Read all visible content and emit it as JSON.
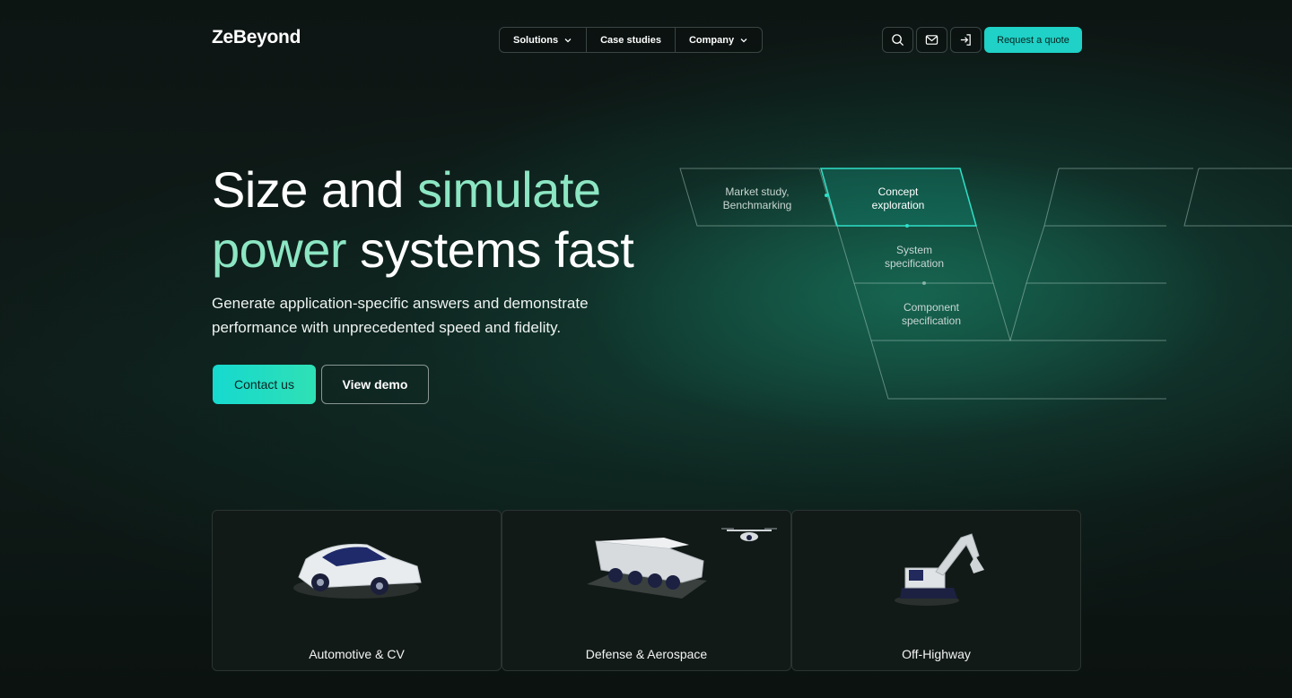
{
  "header": {
    "logo": "ZeBeyond",
    "nav": [
      {
        "label": "Solutions",
        "has_dropdown": true
      },
      {
        "label": "Case studies",
        "has_dropdown": false
      },
      {
        "label": "Company",
        "has_dropdown": true
      }
    ],
    "icons": [
      "search-icon",
      "mail-icon",
      "login-icon"
    ],
    "cta_label": "Request a quote"
  },
  "hero": {
    "title_line1_a": "Size and ",
    "title_line1_b": "simulate",
    "title_line2_a": "power",
    "title_line2_b": " systems fast",
    "subtitle": "Generate application-specific answers and demonstrate performance with unprecedented speed and fidelity.",
    "primary_button": "Contact us",
    "secondary_button": "View demo"
  },
  "diagram": {
    "steps": [
      {
        "line1": "Market study,",
        "line2": "Benchmarking"
      },
      {
        "line1": "Concept",
        "line2": "exploration"
      },
      {
        "line1": "System",
        "line2": "specification"
      },
      {
        "line1": "Component",
        "line2": "specification"
      }
    ]
  },
  "cards": [
    {
      "label": "Automotive & CV",
      "icon": "car-illustration"
    },
    {
      "label": "Defense & Aerospace",
      "icon": "military-vehicle-illustration"
    },
    {
      "label": "Off-Highway",
      "icon": "excavator-illustration"
    }
  ],
  "colors": {
    "accent": "#8ce6c3",
    "cta": "#1fd1c6",
    "background": "#0c1412"
  }
}
